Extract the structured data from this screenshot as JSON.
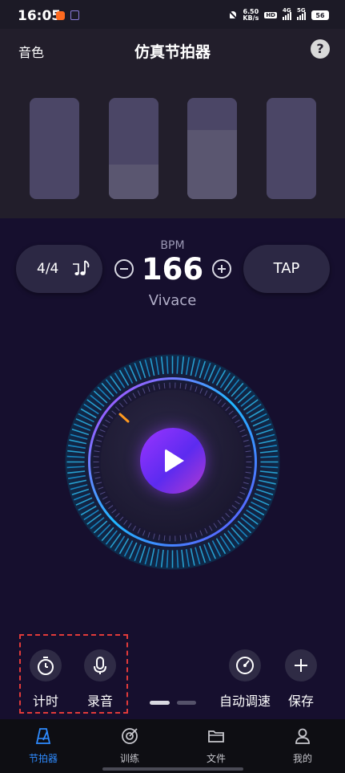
{
  "status_bar": {
    "time": "16:05",
    "net_speed_value": "6.50",
    "net_speed_unit": "KB/s",
    "hd_label": "HD",
    "sim1_label": "4G",
    "sim2_label": "5G",
    "battery": "56"
  },
  "header": {
    "sound_label": "音色",
    "title": "仿真节拍器",
    "help_label": "?"
  },
  "beat_bars": [
    {
      "level": 0.0
    },
    {
      "level": 0.34
    },
    {
      "level": 0.68
    },
    {
      "level": 0.0
    }
  ],
  "controls": {
    "time_signature": "4/4",
    "bpm_label": "BPM",
    "bpm_value": "166",
    "tempo_name": "Vivace",
    "tap_label": "TAP"
  },
  "tools": {
    "timer_label": "计时",
    "record_label": "录音",
    "auto_speed_label": "自动调速",
    "save_label": "保存"
  },
  "pager": {
    "pages": 2,
    "active": 0
  },
  "bottom_nav": {
    "items": [
      {
        "label": "节拍器",
        "icon": "metronome-icon",
        "active": true
      },
      {
        "label": "训练",
        "icon": "target-icon",
        "active": false
      },
      {
        "label": "文件",
        "icon": "folder-icon",
        "active": false
      },
      {
        "label": "我的",
        "icon": "user-icon",
        "active": false
      }
    ]
  },
  "colors": {
    "background": "#160f2e",
    "accent": "#2e8bff",
    "play_gradient_start": "#9b34ff",
    "dial_cyan": "#1fb8ff",
    "highlight_box": "#e03a3a"
  }
}
